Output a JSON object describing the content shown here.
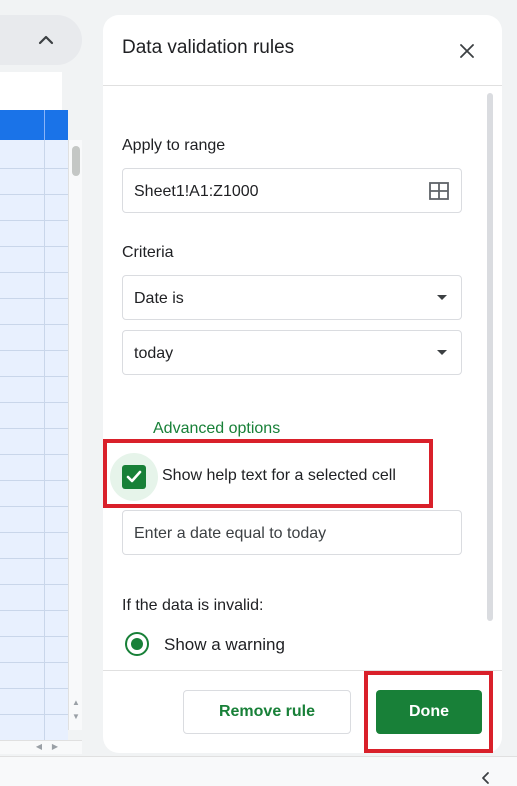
{
  "panel": {
    "title": "Data validation rules",
    "apply_range_label": "Apply to range",
    "range_value": "Sheet1!A1:Z1000",
    "criteria_label": "Criteria",
    "criteria_type": "Date is",
    "criteria_value": "today",
    "advanced_options_label": "Advanced options",
    "help_text_checkbox_label": "Show help text for a selected cell",
    "help_text_checked": true,
    "help_text_placeholder": "Enter a date equal to today",
    "invalid_label": "If the data is invalid:",
    "invalid_option": "Show a warning",
    "remove_label": "Remove rule",
    "done_label": "Done"
  },
  "colors": {
    "accent_green": "#188038",
    "highlight_red": "#d9202a",
    "sheet_header_blue": "#1a73e8",
    "sheet_selection": "#e8f0fe"
  },
  "icons": [
    "chevron-up-icon",
    "close-icon",
    "grid-select-icon",
    "dropdown-caret-icon",
    "checkmark-icon",
    "chevron-left-icon"
  ]
}
